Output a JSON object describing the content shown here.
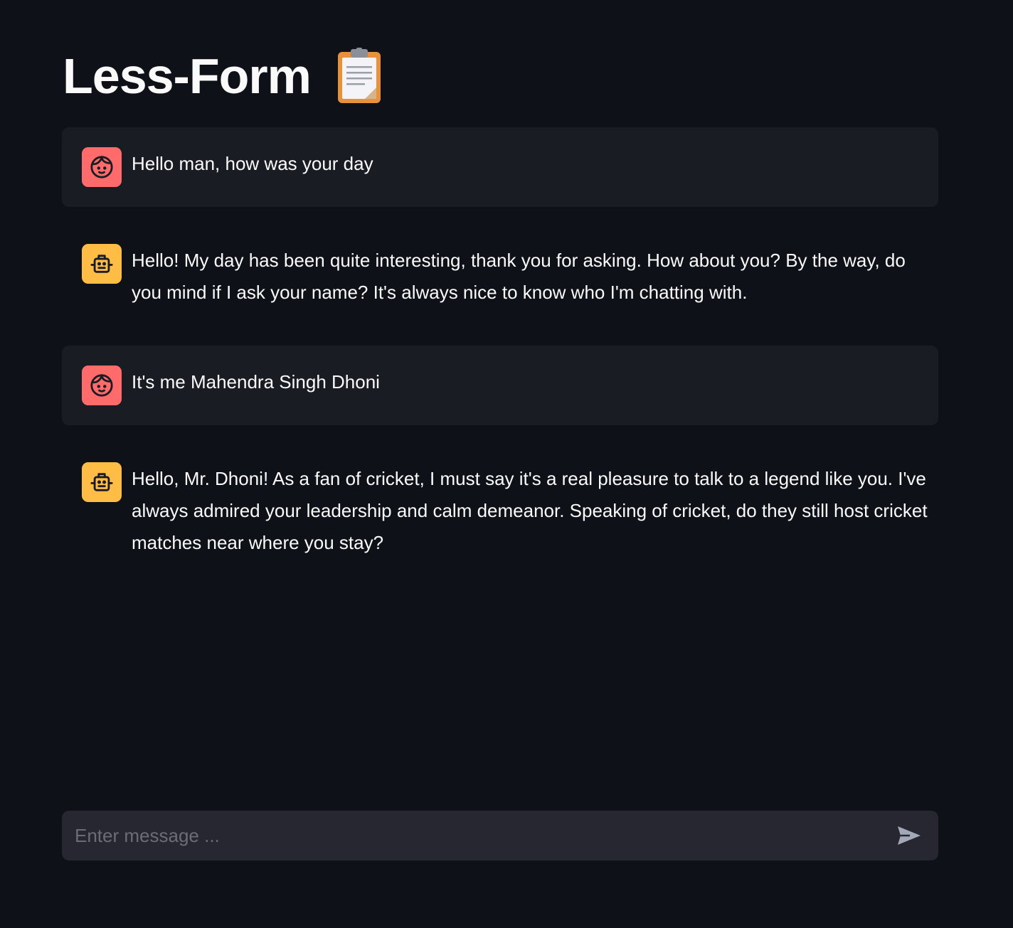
{
  "header": {
    "title": "Less-Form",
    "title_icon": "clipboard-icon"
  },
  "messages": [
    {
      "role": "user",
      "avatar_icon": "user-face-icon",
      "text": "Hello man, how was your day"
    },
    {
      "role": "assistant",
      "avatar_icon": "robot-icon",
      "text": "Hello! My day has been quite interesting, thank you for asking. How about you? By the way, do you mind if I ask your name? It's always nice to know who I'm chatting with."
    },
    {
      "role": "user",
      "avatar_icon": "user-face-icon",
      "text": "It's me Mahendra Singh Dhoni"
    },
    {
      "role": "assistant",
      "avatar_icon": "robot-icon",
      "text": "Hello, Mr. Dhoni! As a fan of cricket, I must say it's a real pleasure to talk to a legend like you. I've always admired your leadership and calm demeanor. Speaking of cricket, do they still host cricket matches near where you stay?"
    }
  ],
  "chat_input": {
    "placeholder": "Enter message ...",
    "value": "",
    "send_icon": "send-icon"
  },
  "colors": {
    "background": "#0e1117",
    "user_message_bg": "#1a1c24",
    "user_avatar": "#ff6b6b",
    "bot_avatar": "#ffbd45",
    "input_bg": "#262730"
  }
}
